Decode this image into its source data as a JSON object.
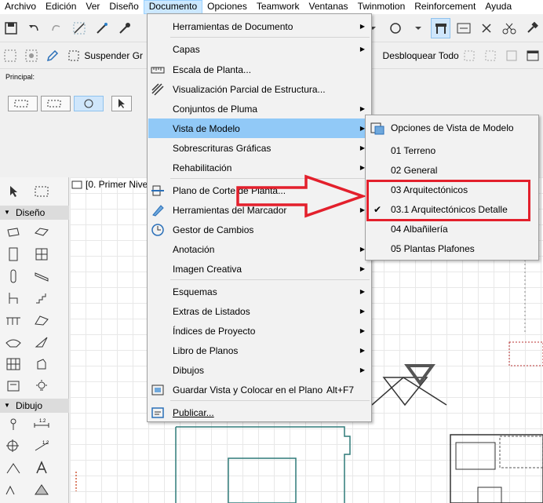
{
  "menubar": {
    "items": [
      "Archivo",
      "Edición",
      "Ver",
      "Diseño",
      "Documento",
      "Opciones",
      "Teamwork",
      "Ventanas",
      "Twinmotion",
      "Reinforcement",
      "Ayuda"
    ],
    "active": "Documento"
  },
  "toolbar2": {
    "suspender_label": "Suspender Gr",
    "desbloquear_label": "Desbloquear Todo"
  },
  "infobox": {
    "label": "Principal:"
  },
  "view": {
    "tab_label": "[0. Primer Nivel"
  },
  "left_panel": {
    "diseno_label": "Diseño",
    "dibujo_label": "Dibujo"
  },
  "documento_menu": {
    "items": [
      {
        "label": "Herramientas de Documento",
        "submenu": true
      },
      {
        "label": "Capas",
        "submenu": true
      },
      {
        "label": "Escala de Planta..."
      },
      {
        "label": "Visualización Parcial de Estructura..."
      },
      {
        "label": "Conjuntos de Pluma",
        "submenu": true
      },
      {
        "label": "Vista de Modelo",
        "submenu": true,
        "highlighted": true
      },
      {
        "label": "Sobrescrituras Gráficas",
        "submenu": true
      },
      {
        "label": "Rehabilitación",
        "submenu": true
      },
      {
        "label": "Plano de Corte de Planta..."
      },
      {
        "label": "Herramientas del Marcador",
        "submenu": true
      },
      {
        "label": "Gestor de Cambios"
      },
      {
        "label": "Anotación",
        "submenu": true
      },
      {
        "label": "Imagen Creativa",
        "submenu": true
      },
      {
        "label": "Esquemas",
        "submenu": true
      },
      {
        "label": "Extras de Listados",
        "submenu": true
      },
      {
        "label": "Índices de Proyecto",
        "submenu": true
      },
      {
        "label": "Libro de Planos",
        "submenu": true
      },
      {
        "label": "Dibujos",
        "submenu": true
      },
      {
        "label": "Guardar Vista y Colocar en el Plano",
        "shortcut": "Alt+F7"
      },
      {
        "label": "Publicar..."
      }
    ]
  },
  "vista_modelo_submenu": {
    "items": [
      {
        "label": "Opciones de Vista de Modelo"
      },
      {
        "label": "01 Terreno"
      },
      {
        "label": "02 General"
      },
      {
        "label": "03 Arquitectónicos"
      },
      {
        "label": "03.1 Arquitectónicos Detalle",
        "checked": true
      },
      {
        "label": "04 Albañilería"
      },
      {
        "label": "05 Plantas Plafones"
      }
    ],
    "check_glyph": "✔"
  },
  "annotation": {
    "color": "#e3202c"
  }
}
